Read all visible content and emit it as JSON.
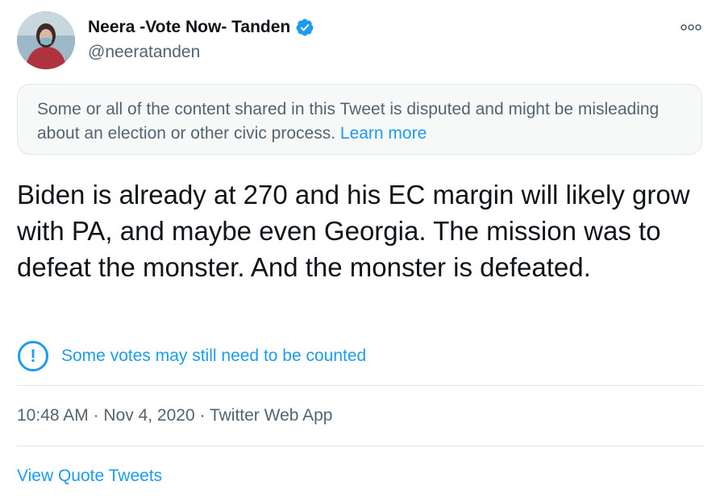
{
  "author": {
    "display_name": "Neera -Vote Now- Tanden",
    "handle": "@neeratanden",
    "avatar_icon": "profile-photo",
    "verified_icon": "verified-badge-icon"
  },
  "more_icon": "more-options-icon",
  "notice": {
    "text": "Some or all of the content shared in this Tweet is disputed and might be misleading about an election or other civic process.",
    "link": "Learn more"
  },
  "tweet": {
    "text": "Biden is already at 270 and his EC margin will likely grow with PA, and maybe even Georgia.  The mission was to defeat the monster.  And the monster is defeated."
  },
  "label": {
    "icon_glyph": "!",
    "text": "Some votes may still need to be counted"
  },
  "meta": {
    "time": "10:48 AM",
    "separator": " · ",
    "date": "Nov 4, 2020",
    "source": "Twitter Web App"
  },
  "quote_tweets_label": "View Quote Tweets",
  "colors": {
    "accent": "#1d9bf0",
    "secondary_text": "#536471",
    "border": "#e1e8ed"
  }
}
